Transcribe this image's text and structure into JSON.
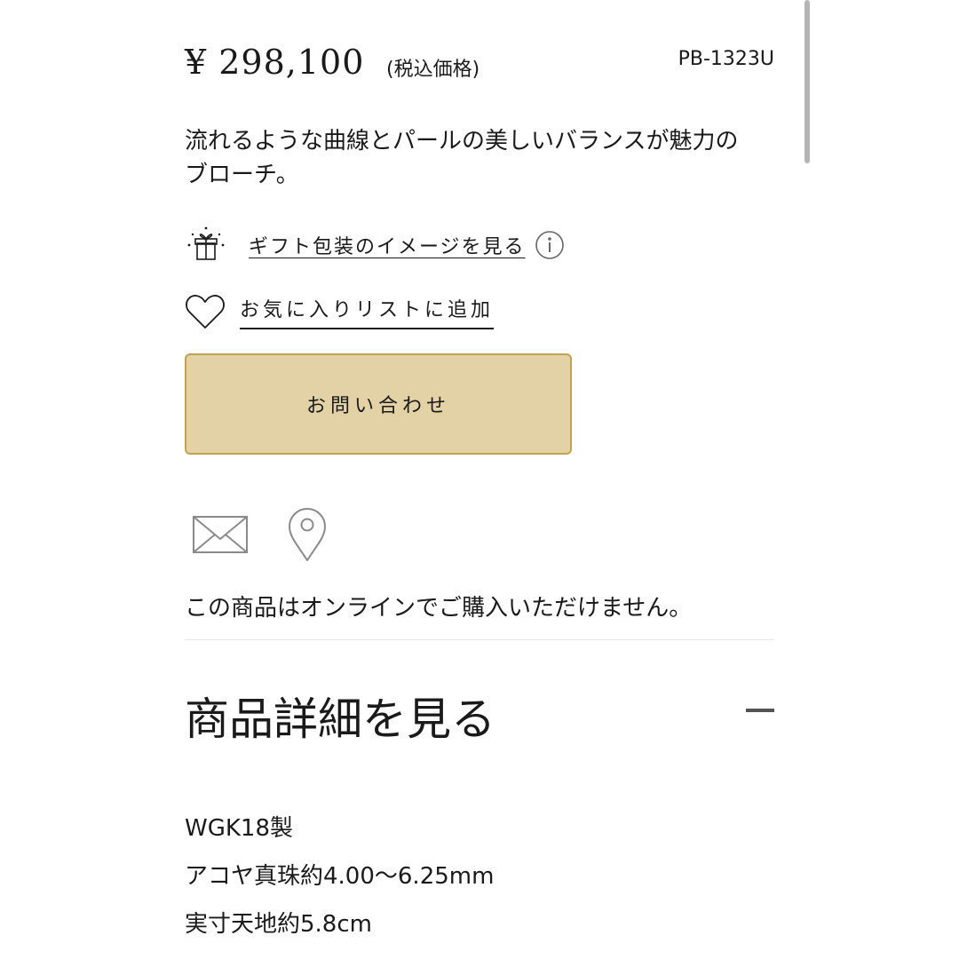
{
  "product": {
    "price": "¥ 298,100",
    "tax_note": "(税込価格)",
    "sku": "PB-1323U",
    "description_line1": "流れるような曲線とパールの美しいバランスが魅力の",
    "description_line2": "ブローチ。"
  },
  "actions": {
    "gift_link": "ギフト包装のイメージを見る",
    "favorite_link": "お気に入りリストに追加",
    "inquiry_button": "お問い合わせ"
  },
  "availability": {
    "message": "この商品はオンラインでご購入いただけません。"
  },
  "details": {
    "title": "商品詳細を見る",
    "specs": [
      "WGK18製",
      "アコヤ真珠約4.00〜6.25mm",
      "実寸天地約5.8cm"
    ]
  },
  "icons": {
    "gift": "gift-icon",
    "info": "info-icon",
    "heart": "heart-icon",
    "mail": "mail-icon",
    "location": "location-pin-icon",
    "collapse": "minus-icon"
  },
  "colors": {
    "button_bg": "#e3d2a6",
    "button_border": "#c3a24f",
    "text": "#1a1a1a"
  }
}
